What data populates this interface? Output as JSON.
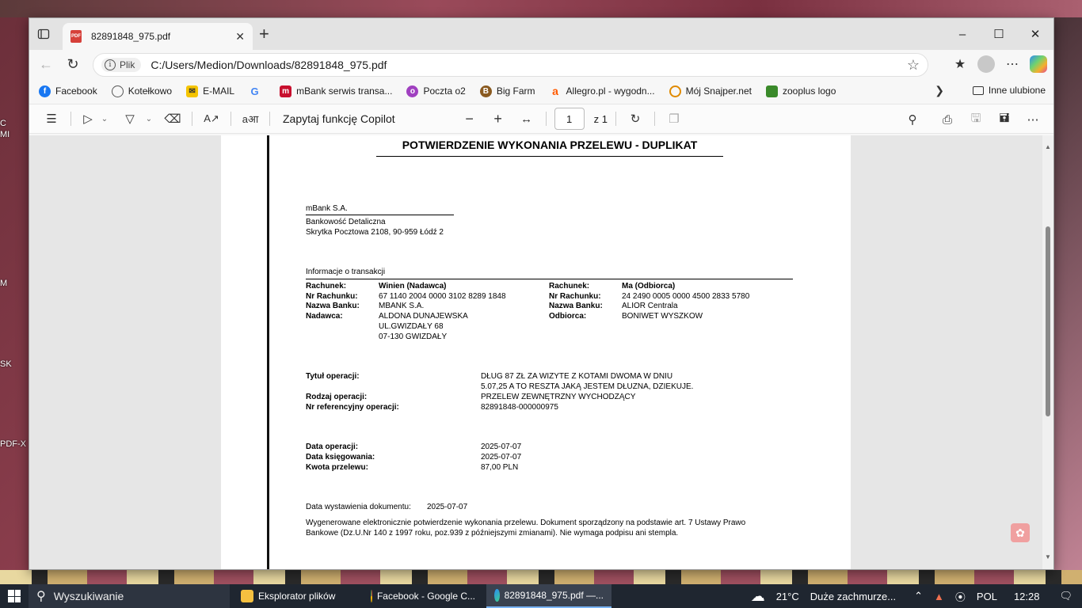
{
  "desktop": {
    "labels": [
      "C",
      "MI",
      "M",
      "SK",
      "PDF-X"
    ]
  },
  "tab": {
    "title": "82891848_975.pdf",
    "close": "✕",
    "new": "+"
  },
  "window_controls": {
    "minimize": "–",
    "maximize": "☐",
    "close": "✕"
  },
  "address": {
    "origin_label": "Plik",
    "url": "C:/Users/Medion/Downloads/82891848_975.pdf"
  },
  "favorites": [
    {
      "label": "Facebook",
      "icon": "facebook-icon",
      "color": "#1877f2"
    },
    {
      "label": "Kotełkowo",
      "icon": "globe-icon",
      "color": "#555555"
    },
    {
      "label": "E-MAIL",
      "icon": "mail-icon",
      "color": "#f5c400"
    },
    {
      "label": "",
      "icon": "google-icon",
      "color": "#4285f4"
    },
    {
      "label": "mBank serwis transa...",
      "icon": "mbank-icon",
      "color": "#c8102e"
    },
    {
      "label": "Poczta o2",
      "icon": "o2-icon",
      "color": "#a040c0"
    },
    {
      "label": "Big Farm",
      "icon": "bigfarm-icon",
      "color": "#8a5a20"
    },
    {
      "label": "Allegro.pl - wygodn...",
      "icon": "allegro-icon",
      "color": "#ff5a00"
    },
    {
      "label": "Mój Snajper.net",
      "icon": "snajper-icon",
      "color": "#e08a00"
    },
    {
      "label": "zooplus logo",
      "icon": "zooplus-icon",
      "color": "#3a8a2a"
    }
  ],
  "favorites_other": "Inne ulubione",
  "pdf_toolbar": {
    "copilot_prompt": "Zapytaj funkcję Copilot",
    "page_current": "1",
    "page_total": "z 1"
  },
  "document": {
    "heading": "POTWIERDZENIE WYKONANIA PRZELEWU - DUPLIKAT",
    "bank_name": "mBank S.A.",
    "bank_dept": "Bankowość Detaliczna",
    "bank_address": "Skrytka Pocztowa 2108, 90-959 Łódź 2",
    "section_info": "Informacje o transakcji",
    "sender": {
      "rachunek_label": "Rachunek:",
      "rachunek_value": "Winien (Nadawca)",
      "nr_label": "Nr Rachunku:",
      "nr_value": "67 1140 2004 0000 3102 8289 1848",
      "bank_label": "Nazwa Banku:",
      "bank_value": "MBANK S.A.",
      "party_label": "Nadawca:",
      "party_line1": "ALDONA DUNAJEWSKA",
      "party_line2": "UL.GWIZDAŁY 68",
      "party_line3": "07-130 GWIZDAŁY"
    },
    "receiver": {
      "rachunek_label": "Rachunek:",
      "rachunek_value": "Ma (Odbiorca)",
      "nr_label": "Nr Rachunku:",
      "nr_value": "24 2490 0005 0000 4500 2833 5780",
      "bank_label": "Nazwa Banku:",
      "bank_value": "ALIOR Centrala",
      "party_label": "Odbiorca:",
      "party_line1": "BONIWET WYSZKOW"
    },
    "title_label": "Tytuł operacji:",
    "title_line1": "DŁUG 87 ZŁ ZA WIZYTE Z KOTAMI DWOMA W DNIU",
    "title_line2": "5.07,25 A TO RESZTA JAKĄ JESTEM DŁUZNA, DZIEKUJE.",
    "type_label": "Rodzaj operacji:",
    "type_value": "PRZELEW ZEWNĘTRZNY WYCHODZĄCY",
    "ref_label": "Nr referencyjny operacji:",
    "ref_value": "82891848-000000975",
    "op_date_label": "Data operacji:",
    "op_date_value": "2025-07-07",
    "book_date_label": "Data księgowania:",
    "book_date_value": "2025-07-07",
    "amount_label": "Kwota przelewu:",
    "amount_value": "87,00 PLN",
    "issue_label": "Data wystawienia dokumentu:",
    "issue_value": "2025-07-07",
    "footer_line1": "Wygenerowane elektronicznie potwierdzenie wykonania przelewu. Dokument sporządzony na podstawie art. 7 Ustawy Prawo",
    "footer_line2": "Bankowe (Dz.U.Nr 140 z 1997 roku, poz.939 z późniejszymi zmianami). Nie wymaga podpisu ani stempla."
  },
  "taskbar": {
    "search_placeholder": "Wyszukiwanie",
    "apps": [
      {
        "label": "Eksplorator plików",
        "color": "#f5c040"
      },
      {
        "label": "Facebook - Google C...",
        "color": "#34a853"
      },
      {
        "label": "82891848_975.pdf —...",
        "color": "#2b8cf5"
      }
    ],
    "weather_temp": "21°C",
    "weather_desc": "Duże zachmurze...",
    "language": "POL",
    "time": "12:28"
  }
}
